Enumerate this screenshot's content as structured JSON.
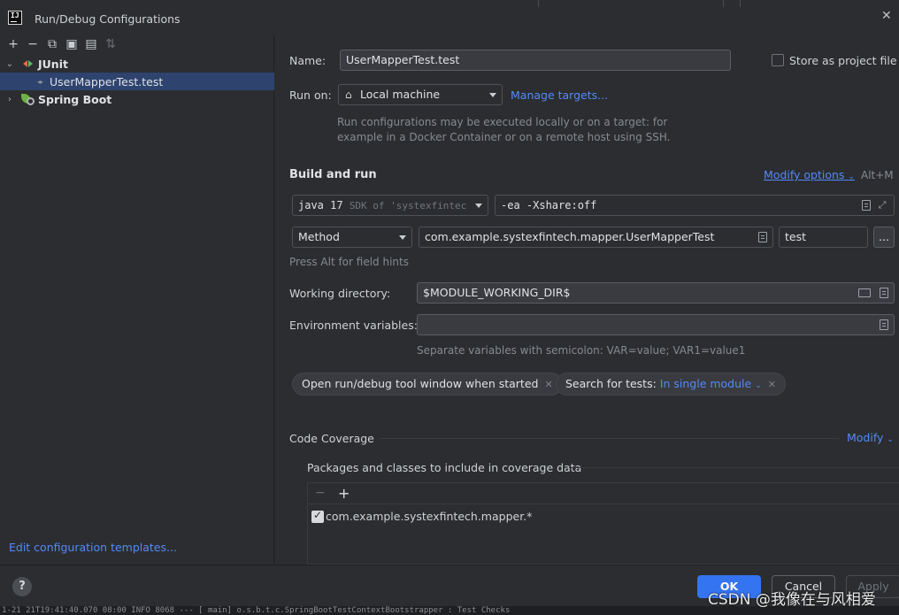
{
  "window": {
    "title": "Run/Debug Configurations",
    "close_glyph": "✕"
  },
  "toolbar": {
    "add": "+",
    "remove": "−",
    "copy": "⧉",
    "save": "▣",
    "new_folder": "▤",
    "sort": "⇅"
  },
  "tree": {
    "junit": {
      "label": "JUnit",
      "chevron": "⌄"
    },
    "usermapper": {
      "label": "UserMapperTest.test",
      "marker": "◂▸"
    },
    "spring": {
      "label": "Spring Boot",
      "chevron": "›"
    }
  },
  "edit_templates": "Edit configuration templates...",
  "name": {
    "label": "Name:",
    "value": "UserMapperTest.test"
  },
  "store_as_project_file": {
    "label": "Store as project file",
    "checked": false
  },
  "run_on": {
    "label": "Run on:",
    "value": "Local machine",
    "manage_link": "Manage targets...",
    "hint_line1": "Run configurations may be executed locally or on a target: for",
    "hint_line2": "example in a Docker Container or on a remote host using SSH."
  },
  "build_and_run": {
    "title": "Build and run",
    "modify_options": "Modify options",
    "modify_shortcut": "Alt+M",
    "jdk_name": "java 17",
    "jdk_detail": "SDK of 'systexfintec",
    "vm_options": "-ea -Xshare:off",
    "test_kind": "Method",
    "class_name": "com.example.systexfintech.mapper.UserMapperTest",
    "method_name": "test",
    "more_button": "...",
    "field_hint": "Press Alt for field hints"
  },
  "working_directory": {
    "label": "Working directory:",
    "value": "$MODULE_WORKING_DIR$"
  },
  "environment_variables": {
    "label": "Environment variables:",
    "value": "",
    "hint": "Separate variables with semicolon: VAR=value; VAR1=value1"
  },
  "chips": {
    "open_tool_window": "Open run/debug tool window when started",
    "search_tests_prefix": "Search for tests:",
    "search_tests_value": "In single module",
    "remove_glyph": "✕"
  },
  "code_coverage": {
    "title": "Code Coverage",
    "modify": "Modify",
    "packages_label": "Packages and classes to include in coverage data",
    "remove_glyph": "−",
    "add_glyph": "+",
    "items": [
      {
        "label": "com.example.systexfintech.mapper.*",
        "checked": true
      }
    ]
  },
  "footer": {
    "help": "?",
    "ok": "OK",
    "cancel": "Cancel",
    "apply": "Apply"
  },
  "console_strip": "1-21 21T19:41:40.070 08:00  INFO 8068 ---  [    main] o.s.b.t.c.SpringBootTestContextBootstrapper : Test    Checks",
  "watermark": "CSDN @我像在与风相爱",
  "colors": {
    "accent": "#3574f0",
    "link": "#548af7",
    "selection": "#2e436e",
    "background": "#2b2d30"
  }
}
